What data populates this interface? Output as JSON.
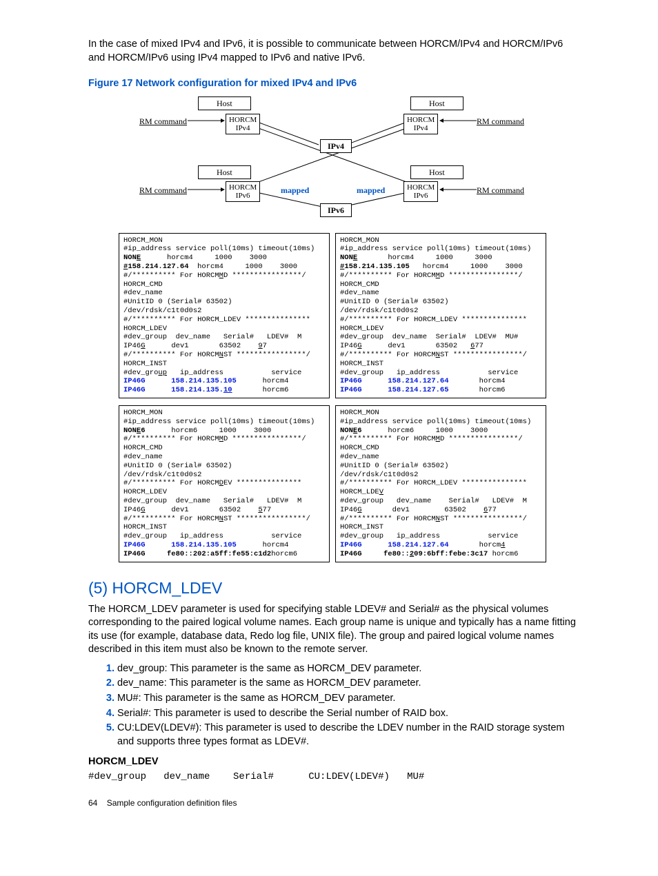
{
  "intro": "In the case of mixed IPv4 and IPv6, it is possible to communicate between HORCM/IPv4 and HORCM/IPv6 and HORCM/IPv6 using IPv4 mapped to IPv6 and native IPv6.",
  "figure_caption": "Figure 17 Network configuration for mixed IPv4 and IPv6",
  "diagram": {
    "host": "Host",
    "rm_command": "RM command",
    "horcm": "HORCM",
    "ipv4": "IPv4",
    "ipv6": "IPv6",
    "mapped": "mapped"
  },
  "config_boxes": {
    "box1": "HORCM_MON\n#ip_address service poll(10ms) timeout(10ms)\n<b>NON<u>E</u></b>      horcm4     1000    3000\n<b><u>#</u>158.214.127.64</b>  horcm4     1000    3000\n#/********** For HORCM<u>M</u>D ****************/\nHORCM_CMD\n#dev_name\n#UnitID 0 (Serial# 63502)\n/dev/rdsk/c1t0d0s2\n#/********** For HORCM_LDEV ***************\nHORCM_LDEV\n#dev_group  dev_name   Serial#   LDEV#  M\nIP46<u>G</u>      dev1       63502    <u>9</u>7\n#/********** For HORCM<u>N</u>ST ****************/\nHORCM_INST\n#dev_gro<u>up</u>   ip_address           service\n<bl>IP46G      158.214.135.105</bl>      horcm4\n<bl>IP46G      158.214.135.<u>10</u></bl>       horcm6",
    "box2": "HORCM_MON\n#ip_address service poll(10ms) timeout(10ms)\n<b>NON<u>E</u></b>       horcm4     1000     3000\n<b><u>#</u>158.214.135.105</b>   horcm4     1000    3000\n#/********** For HORCM<u>M</u>D ****************/\nHORCM_CMD\n#dev_name\n#UnitID 0 (Serial# 63502)\n/dev/rdsk/c1t0d0s2\n#/********** For HORCM_LDEV ***************\nHORCM_LDEV\n#dev_group  dev_name  Serial#  LDEV#  MU#\nIP46<u>G</u>      dev1       63502   <u>6</u>77\n#/********** For HORCM<u>N</u>ST ****************/\nHORCM_INST\n#dev_group   ip_address           service\n<bl>IP46G      158.214.127.64</bl>       horcm4\n<bl>IP46G      158.214.127.65</bl>       horcm6",
    "box3": "HORCM_MON\n#ip_address service poll(10ms) timeout(10ms)\n<b>NON<u>E</u>6</b>      horcm6     1000    3000\n#/********** For HORCM<u>M</u>D ****************/\nHORCM_CMD\n#dev_name\n#UnitID 0 (Serial# 63502)\n/dev/rdsk/c1t0d0s2\n#/********** For HORCM<u>D</u>EV ***************\nHORCM_LDEV\n#dev_group  dev_name   Serial#   LDEV#  M\nIP46<u>G</u>      dev1       63502    <u>5</u>77\n#/********** For HORCM<u>N</u>ST ****************/\nHORCM_INST\n#dev_group   ip_address           service\n<bl>IP46G      158.214.135.105</bl>      horcm4\n<b>IP46G     fe80::202:a5ff:fe55:c1d2</b>horcm6",
    "box4": "HORCM_MON\n#ip_address service poll(10ms) timeout(10ms)\n<b>NON<u>E</u>6</b>      horcm6     1000    3000\n#/********** For HORCM<u>M</u>D ****************/\nHORCM_CMD\n#dev_name\n#UnitID 0 (Serial# 63502)\n/dev/rdsk/c1t0d0s2\n#/********** For HORCM_LDEV ***************\nHORCM_LDE<u>V</u>\n#dev_group   dev_name    Serial#   LDEV#  M\nIP46<u>G</u>       dev1        63502    <u>6</u>77\n#/********** For HORCM<u>N</u>ST ****************/\nHORCM_INST\n#dev_group   ip_address           service\n<bl>IP46G      158.214.127.64</bl>       horcm<u>4</u>\n<b>IP46G     fe80::<u>2</u>09:6bff:febe:3c17</b> horcm6"
  },
  "section_title": "(5) HORCM_LDEV",
  "section_body": "The HORCM_LDEV parameter is used for specifying stable LDEV# and Serial# as the physical volumes corresponding to the paired logical volume names. Each group name is unique and typically has a name fitting its use (for example, database data, Redo log file, UNIX file). The group and paired logical volume names described in this item must also be known to the remote server.",
  "params": [
    "dev_group: This parameter is the same as HORCM_DEV parameter.",
    "dev_name: This parameter is the same as HORCM_DEV parameter.",
    "MU#: This parameter is the same as HORCM_DEV parameter.",
    "Serial#: This parameter is used to describe the Serial number of RAID box.",
    "CU:LDEV(LDEV#): This parameter is used to describe the LDEV number in the RAID storage system and supports three types format as LDEV#."
  ],
  "horcm_heading": "HORCM_LDEV",
  "code_line": "#dev_group   dev_name    Serial#      CU:LDEV(LDEV#)   MU#",
  "footer_page": "64",
  "footer_text": "Sample configuration definition files"
}
